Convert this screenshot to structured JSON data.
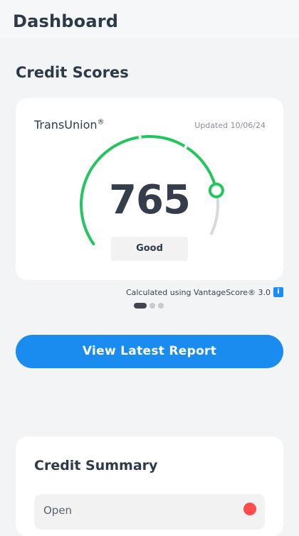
{
  "header": {
    "title": "Dashboard"
  },
  "credit_scores": {
    "section_title": "Credit Scores",
    "card": {
      "bureau": "TransUnion",
      "bureau_mark": "®",
      "updated": "Updated 10/06/24",
      "score": "765",
      "score_min": 300,
      "score_max": 850,
      "rating": "Good",
      "gauge_color": "#22c55e",
      "gauge_track_color": "#d9d9d9"
    },
    "calculated_text": "Calculated using VantageScore® 3.0",
    "info_icon": "info-icon",
    "pagination": {
      "total": 3,
      "active_index": 0
    }
  },
  "report_button": {
    "label": "View Latest Report",
    "color": "#1a8cf0"
  },
  "credit_summary": {
    "title": "Credit Summary",
    "rows": [
      {
        "label": "Open",
        "indicator_color": "#ff4d4d"
      }
    ]
  }
}
